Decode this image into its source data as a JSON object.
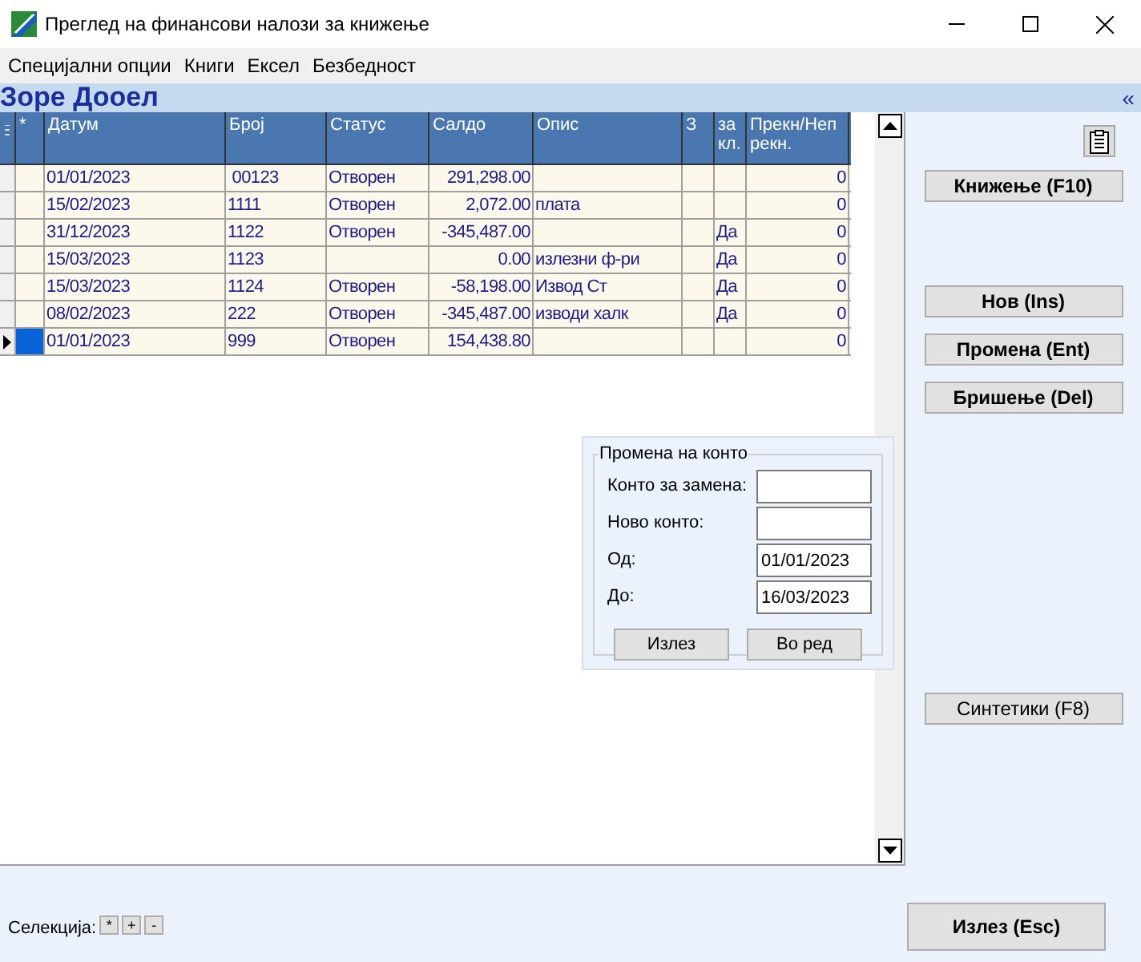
{
  "window": {
    "title": "Преглед на финансови налози за книжење"
  },
  "menu": [
    "Специјални опции",
    "Книги",
    "Ексел",
    "Безбедност"
  ],
  "company": {
    "name": "Зоре Дооел",
    "collapse": "«"
  },
  "table": {
    "columns": [
      "*",
      "Датум",
      "Број",
      "Статус",
      "Салдо",
      "Опис",
      "З",
      "за кл.",
      "Прекн/Непрекн."
    ],
    "rows": [
      {
        "date": "01/01/2023",
        "number": " 00123",
        "status": "Отворен",
        "balance": "291,298.00",
        "interrupted": "0",
        "selected": false
      },
      {
        "date": "15/02/2023",
        "number": "1111",
        "status": "Отворен",
        "balance": "2,072.00",
        "description": "плата",
        "interrupted": "0",
        "selected": false
      },
      {
        "date": "31/12/2023",
        "number": "1122",
        "status": "Отворен",
        "balance": "-345,487.00",
        "for_close": "Да",
        "interrupted": "0",
        "selected": false
      },
      {
        "date": "15/03/2023",
        "number": "1123",
        "balance": "0.00",
        "description": "излезни ф-ри",
        "for_close": "Да",
        "interrupted": "0",
        "selected": false
      },
      {
        "date": "15/03/2023",
        "number": "1124",
        "status": "Отворен",
        "balance": "-58,198.00",
        "description": "Извод Ст",
        "for_close": "Да",
        "interrupted": "0",
        "selected": false
      },
      {
        "date": "08/02/2023",
        "number": "222",
        "status": "Отворен",
        "balance": "-345,487.00",
        "description": "изводи халк",
        "for_close": "Да",
        "interrupted": "0",
        "selected": false
      },
      {
        "date": "01/01/2023",
        "number": "999",
        "status": "Отворен",
        "balance": "154,438.80",
        "interrupted": "0",
        "selected": true
      }
    ]
  },
  "account_change": {
    "title": "Промена на конто",
    "fields": [
      {
        "label": "Конто за замена:"
      },
      {
        "label": "Ново конто:"
      },
      {
        "label": "Од:",
        "value": "01/01/2023"
      },
      {
        "label": "До:",
        "value": "16/03/2023"
      }
    ],
    "buttons": [
      "Излез",
      "Во ред"
    ]
  },
  "actions": [
    {
      "label": "Книжење (F10)",
      "bold": true
    },
    {
      "label": "Нов (Ins)",
      "bold": true
    },
    {
      "label": "Промена (Ent)",
      "bold": true
    },
    {
      "label": "Бришење (Del)",
      "bold": true
    },
    {
      "label": "Синтетики (F8)",
      "bold": false
    }
  ],
  "footer": {
    "selection_label": "Селекција:",
    "selection_buttons": [
      "*",
      "+",
      "-"
    ],
    "exit": "Излез (Esc)"
  }
}
